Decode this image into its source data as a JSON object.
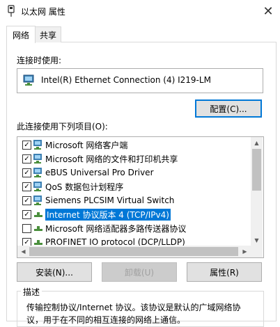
{
  "window": {
    "title": "以太网 属性",
    "close_glyph": "✕"
  },
  "tabs": [
    {
      "label": "网络",
      "active": true
    },
    {
      "label": "共享",
      "active": false
    }
  ],
  "connect_using": {
    "label": "连接时使用:",
    "adapter": "Intel(R) Ethernet Connection (4) I219-LM",
    "adapter_icon": "network-adapter-icon"
  },
  "configure_button": "配置(C)...",
  "items_label": "此连接使用下列项目(O):",
  "items": [
    {
      "label": "Microsoft 网络客户端",
      "checked": true,
      "icon": "network-client-icon"
    },
    {
      "label": "Microsoft 网络的文件和打印机共享",
      "checked": true,
      "icon": "network-client-icon"
    },
    {
      "label": "eBUS Universal Pro Driver",
      "checked": true,
      "icon": "network-client-icon"
    },
    {
      "label": "QoS 数据包计划程序",
      "checked": true,
      "icon": "network-client-icon"
    },
    {
      "label": "Siemens PLCSIM Virtual Switch",
      "checked": true,
      "icon": "network-client-icon"
    },
    {
      "label": "Internet 协议版本 4 (TCP/IPv4)",
      "checked": true,
      "icon": "protocol-icon",
      "selected": true
    },
    {
      "label": "Microsoft 网络适配器多路传送器协议",
      "checked": false,
      "icon": "protocol-icon"
    },
    {
      "label": "PROFINET IO protocol (DCP/LLDP)",
      "checked": true,
      "icon": "protocol-icon"
    }
  ],
  "buttons": {
    "install": "安装(N)...",
    "uninstall": "卸载(U)",
    "properties": "属性(R)"
  },
  "description": {
    "legend": "描述",
    "text": "传输控制协议/Internet 协议。该协议是默认的广域网络协议，用于在不同的相互连接的网络上通信。"
  },
  "colors": {
    "accent": "#0078d7",
    "selection": "#0078d7"
  }
}
